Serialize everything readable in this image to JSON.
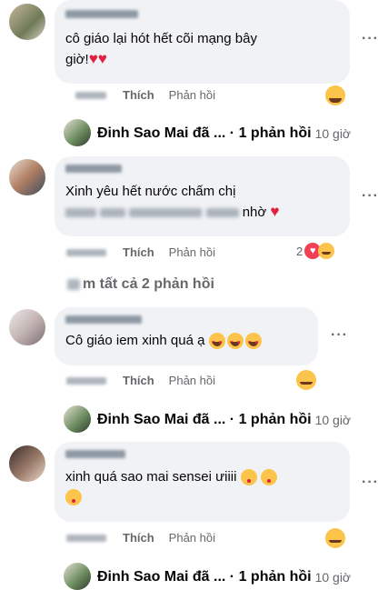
{
  "comments": [
    {
      "text_line1": "cô giáo lại hót hết cõi mạng bây",
      "text_line2": "giờ!",
      "text_hearts": "♥♥",
      "like": "Thích",
      "reply": "Phản hồi"
    },
    {
      "text_line1": "Xinh yêu hết nước chấm chị",
      "text_line2_end": "nhờ",
      "text_heart": "♥",
      "like": "Thích",
      "reply": "Phản hồi",
      "reaction_count": "2"
    },
    {
      "text_line1": "Cô giáo iem xinh quá ạ",
      "like": "Thích",
      "reply": "Phản hồi"
    },
    {
      "text_line1": "xinh quá sao mai sensei ưiiii",
      "like": "Thích",
      "reply": "Phản hồi"
    }
  ],
  "reply_summary": {
    "label": "Đinh Sao Mai đã ... · 1 phản hồi",
    "time": "10 giờ"
  },
  "view_all_replies": "m tất cả 2 phản hồi",
  "more": "···",
  "colors": {
    "bubble": "#f0f2f5",
    "secondary_text": "#65676b",
    "heart": "#e41e3f",
    "emoji": "#fcc44b"
  },
  "icons": [
    "more-options-icon",
    "haha-reaction-icon",
    "love-reaction-icon",
    "care-reaction-icon",
    "heart-eyes-emoji-icon",
    "blowing-kiss-emoji-icon"
  ]
}
